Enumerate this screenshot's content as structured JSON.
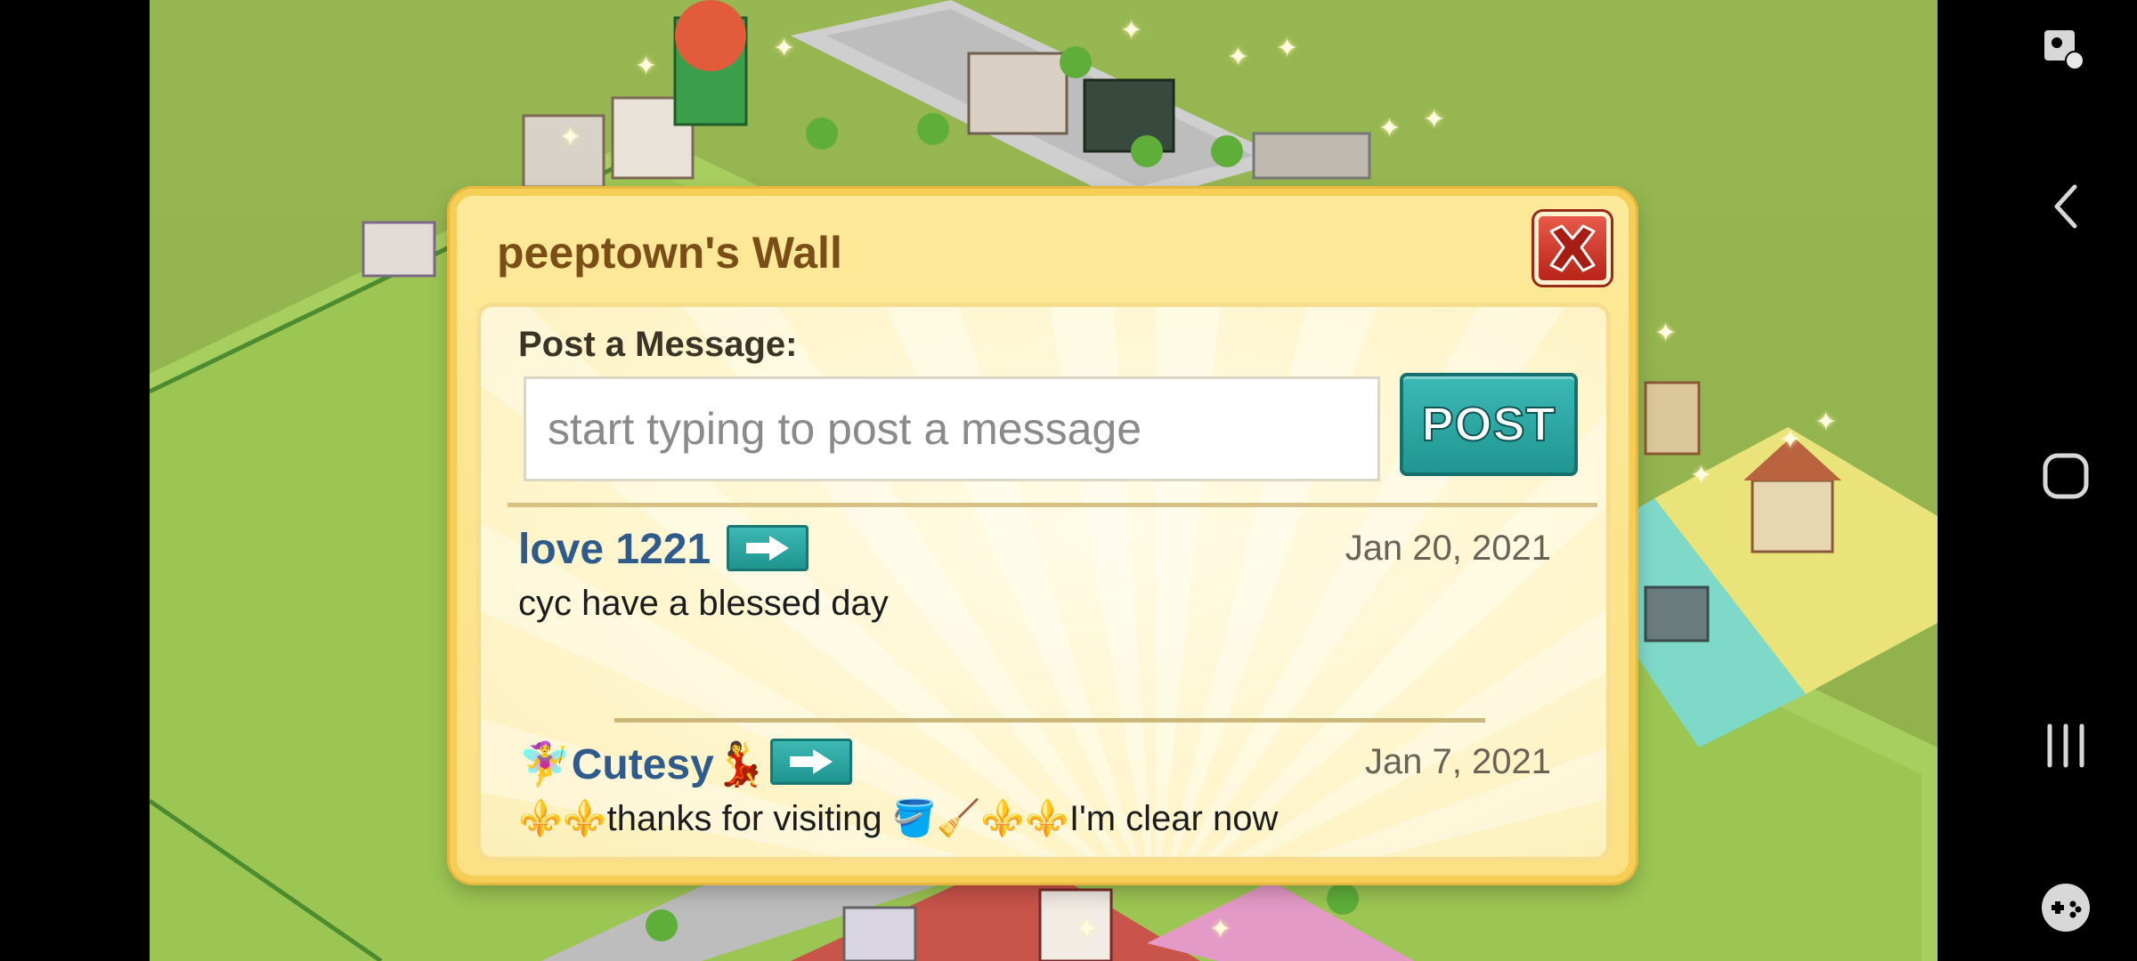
{
  "wall": {
    "title": "peeptown's Wall",
    "post_label": "Post a Message:",
    "input_placeholder": "start typing to post a message",
    "input_value": "",
    "post_button": "POST"
  },
  "posts": [
    {
      "author": "love 1221",
      "date": "Jan 20, 2021",
      "text": "cyc have a blessed day"
    },
    {
      "author": "🧚‍♀️Cutesy💃",
      "date": "Jan 7, 2021",
      "text": "⚜️⚜️thanks for visiting 🪣🧹⚜️⚜️I'm clear now"
    }
  ],
  "icons": {
    "close": "close-icon",
    "visit": "arrow-right-icon",
    "nav": [
      "screenshot-touch-icon",
      "back-icon",
      "home-icon",
      "recents-icon",
      "game-tools-icon"
    ]
  },
  "colors": {
    "dialog_bg": "#fde99a",
    "title": "#7a4e16",
    "author": "#2f5a8c",
    "teal_button": "#2aa6a2",
    "close_red": "#d23a2c"
  }
}
